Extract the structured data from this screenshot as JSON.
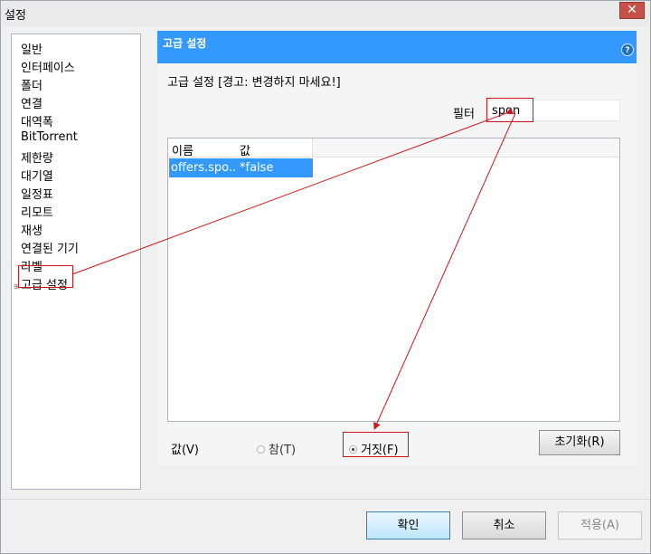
{
  "window": {
    "title": "설정",
    "close_glyph": "✕"
  },
  "sidebar": {
    "items": [
      {
        "label": "일반"
      },
      {
        "label": "인터페이스"
      },
      {
        "label": "폴더"
      },
      {
        "label": "연결"
      },
      {
        "label": "대역폭"
      },
      {
        "label": "BitTorrent"
      },
      {
        "label": "제한량"
      },
      {
        "label": "대기열"
      },
      {
        "label": "일정표"
      },
      {
        "label": "리모트"
      },
      {
        "label": "재생"
      },
      {
        "label": "연결된 기기"
      },
      {
        "label": "라벨"
      },
      {
        "label": "고급 설정",
        "selected": true
      }
    ]
  },
  "panel": {
    "title": "고급 설정",
    "help_glyph": "?",
    "warning": "고급 설정 [경고: 변경하지 마세요!]",
    "filter": {
      "label": "필터",
      "value": "spon"
    },
    "list": {
      "columns": [
        "이름",
        "값"
      ],
      "rows": [
        {
          "name": "offers.spo...",
          "value": "*false"
        }
      ]
    },
    "value_editor": {
      "label": "값(V)",
      "true_label": "참(T)",
      "false_label": "거짓(F)",
      "selected": "false",
      "reset_label": "초기화(R)"
    }
  },
  "footer": {
    "ok_label": "확인",
    "cancel_label": "취소",
    "apply_label": "적용(A)"
  },
  "colors": {
    "accent": "#3399ff",
    "annotation": "#d0161b"
  }
}
